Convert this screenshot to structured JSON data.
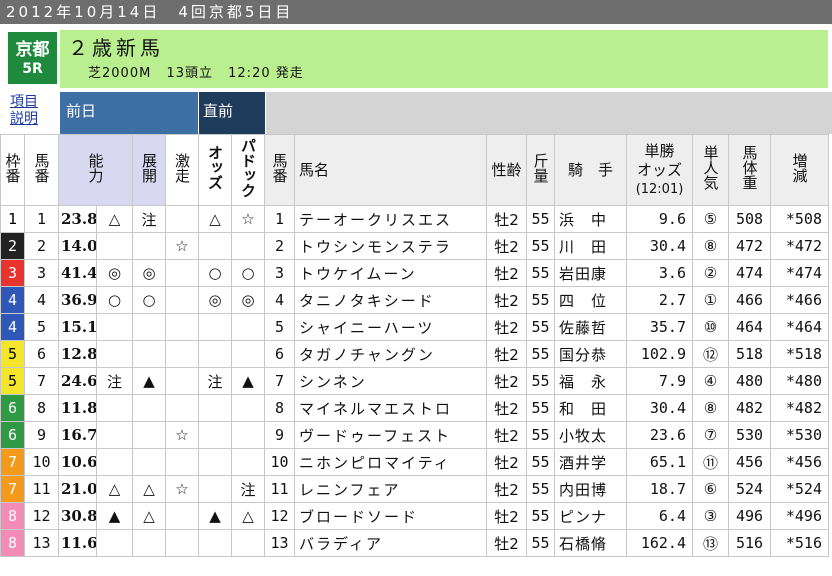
{
  "date_bar": "2012年10月14日　4回京都5日目",
  "venue": {
    "name": "京都",
    "race_no": "5R"
  },
  "race": {
    "title": "２歳新馬",
    "surface_distance": "芝2000M",
    "runners": "13頭立",
    "start_time": "12:20 発走"
  },
  "tabs": {
    "help_line1": "項目",
    "help_line2": "説明",
    "prev_day": "前日",
    "just_before": "直前"
  },
  "headers": {
    "waku": "枠番",
    "umaban": "馬番",
    "ability": "能力",
    "tenkai": "展開",
    "gekiso": "激走",
    "odds": "オッズ",
    "paddock": "パドック",
    "umaban2": "馬番",
    "horse_name": "馬名",
    "sex_age": "性齢",
    "weight_carried": "斤量",
    "jockey": "騎　手",
    "tansho_odds_line1": "単勝",
    "tansho_odds_line2": "オッズ",
    "tansho_odds_line3": "(12:01)",
    "popularity": "単人気",
    "body_weight": "馬体重",
    "diff": "増減"
  },
  "colors": {
    "waku": {
      "1": {
        "bg": "#ffffff",
        "fg": "#000000"
      },
      "2": {
        "bg": "#222222",
        "fg": "#ffffff"
      },
      "3": {
        "bg": "#e8342c",
        "fg": "#ffffff"
      },
      "4": {
        "bg": "#2f57b8",
        "fg": "#ffffff"
      },
      "5": {
        "bg": "#f4e42a",
        "fg": "#000000"
      },
      "6": {
        "bg": "#2f9a43",
        "fg": "#ffffff"
      },
      "7": {
        "bg": "#f39a1d",
        "fg": "#ffffff"
      },
      "8": {
        "bg": "#f28bb6",
        "fg": "#ffffff"
      }
    }
  },
  "rows": [
    {
      "waku": "1",
      "umaban": "1",
      "ability": "23.8",
      "tenkai": "△",
      "gekiso": "",
      "extra": "注",
      "odds_mark": "△",
      "paddock": "☆",
      "name": "テーオークリスエス",
      "sex": "牡2",
      "kin": "55",
      "jockey": "浜　中",
      "odds": "9.6",
      "pop": "⑤",
      "weight": "508",
      "diff": "*508"
    },
    {
      "waku": "2",
      "umaban": "2",
      "ability": "14.0",
      "tenkai": "",
      "gekiso": "☆",
      "extra": "",
      "odds_mark": "",
      "paddock": "",
      "name": "トウシンモンステラ",
      "sex": "牡2",
      "kin": "55",
      "jockey": "川　田",
      "odds": "30.4",
      "pop": "⑧",
      "weight": "472",
      "diff": "*472"
    },
    {
      "waku": "3",
      "umaban": "3",
      "ability": "41.4",
      "tenkai": "◎",
      "gekiso": "",
      "extra": "◎",
      "odds_mark": "○",
      "paddock": "○",
      "name": "トウケイムーン",
      "sex": "牡2",
      "kin": "55",
      "jockey": "岩田康",
      "odds": "3.6",
      "pop": "②",
      "weight": "474",
      "diff": "*474"
    },
    {
      "waku": "4",
      "umaban": "4",
      "ability": "36.9",
      "tenkai": "○",
      "gekiso": "",
      "extra": "○",
      "odds_mark": "◎",
      "paddock": "◎",
      "name": "タニノタキシード",
      "sex": "牡2",
      "kin": "55",
      "jockey": "四　位",
      "odds": "2.7",
      "pop": "①",
      "weight": "466",
      "diff": "*466"
    },
    {
      "waku": "4",
      "umaban": "5",
      "ability": "15.1",
      "tenkai": "",
      "gekiso": "",
      "extra": "",
      "odds_mark": "",
      "paddock": "",
      "name": "シャイニーハーツ",
      "sex": "牡2",
      "kin": "55",
      "jockey": "佐藤哲",
      "odds": "35.7",
      "pop": "⑩",
      "weight": "464",
      "diff": "*464"
    },
    {
      "waku": "5",
      "umaban": "6",
      "ability": "12.8",
      "tenkai": "",
      "gekiso": "",
      "extra": "",
      "odds_mark": "",
      "paddock": "",
      "name": "タガノチャングン",
      "sex": "牡2",
      "kin": "55",
      "jockey": "国分恭",
      "odds": "102.9",
      "pop": "⑫",
      "weight": "518",
      "diff": "*518"
    },
    {
      "waku": "5",
      "umaban": "7",
      "ability": "24.6",
      "tenkai": "注",
      "gekiso": "",
      "extra": "▲",
      "odds_mark": "注",
      "paddock": "▲",
      "name": "シンネン",
      "sex": "牡2",
      "kin": "55",
      "jockey": "福　永",
      "odds": "7.9",
      "pop": "④",
      "weight": "480",
      "diff": "*480"
    },
    {
      "waku": "6",
      "umaban": "8",
      "ability": "11.8",
      "tenkai": "",
      "gekiso": "",
      "extra": "",
      "odds_mark": "",
      "paddock": "",
      "name": "マイネルマエストロ",
      "sex": "牡2",
      "kin": "55",
      "jockey": "和　田",
      "odds": "30.4",
      "pop": "⑧",
      "weight": "482",
      "diff": "*482"
    },
    {
      "waku": "6",
      "umaban": "9",
      "ability": "16.7",
      "tenkai": "",
      "gekiso": "☆",
      "extra": "",
      "odds_mark": "",
      "paddock": "",
      "name": "ヴードゥーフェスト",
      "sex": "牡2",
      "kin": "55",
      "jockey": "小牧太",
      "odds": "23.6",
      "pop": "⑦",
      "weight": "530",
      "diff": "*530"
    },
    {
      "waku": "7",
      "umaban": "10",
      "ability": "10.6",
      "tenkai": "",
      "gekiso": "",
      "extra": "",
      "odds_mark": "",
      "paddock": "",
      "name": "ニホンピロマイティ",
      "sex": "牡2",
      "kin": "55",
      "jockey": "酒井学",
      "odds": "65.1",
      "pop": "⑪",
      "weight": "456",
      "diff": "*456"
    },
    {
      "waku": "7",
      "umaban": "11",
      "ability": "21.0",
      "tenkai": "△",
      "gekiso": "☆",
      "extra": "△",
      "odds_mark": "",
      "paddock": "注",
      "name": "レニンフェア",
      "sex": "牡2",
      "kin": "55",
      "jockey": "内田博",
      "odds": "18.7",
      "pop": "⑥",
      "weight": "524",
      "diff": "*524"
    },
    {
      "waku": "8",
      "umaban": "12",
      "ability": "30.8",
      "tenkai": "▲",
      "gekiso": "",
      "extra": "△",
      "odds_mark": "▲",
      "paddock": "△",
      "name": "ブロードソード",
      "sex": "牡2",
      "kin": "55",
      "jockey": "ピンナ",
      "odds": "6.4",
      "pop": "③",
      "weight": "496",
      "diff": "*496"
    },
    {
      "waku": "8",
      "umaban": "13",
      "ability": "11.6",
      "tenkai": "",
      "gekiso": "",
      "extra": "",
      "odds_mark": "",
      "paddock": "",
      "name": "バラディア",
      "sex": "牡2",
      "kin": "55",
      "jockey": "石橋脩",
      "odds": "162.4",
      "pop": "⑬",
      "weight": "516",
      "diff": "*516"
    }
  ]
}
